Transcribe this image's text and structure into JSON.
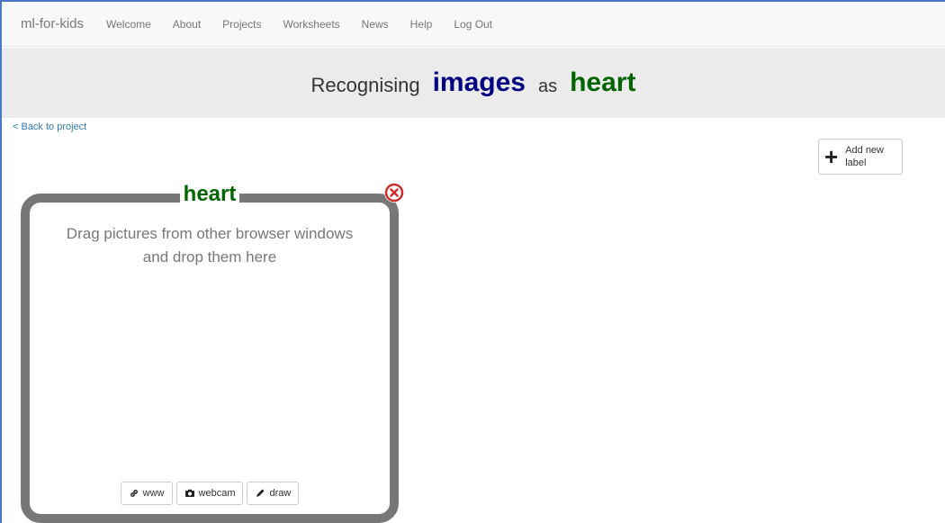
{
  "nav": {
    "brand": "ml-for-kids",
    "items": [
      "Welcome",
      "About",
      "Projects",
      "Worksheets",
      "News",
      "Help",
      "Log Out"
    ]
  },
  "banner": {
    "prefix": "Recognising",
    "type": "images",
    "joiner": "as",
    "label": "heart"
  },
  "back_link": "< Back to project",
  "add_label_button": {
    "line1": "Add new",
    "line2": "label"
  },
  "card": {
    "title": "heart",
    "hint_line1": "Drag pictures from other browser windows",
    "hint_line2": "and drop them here",
    "buttons": {
      "www": "www",
      "webcam": "webcam",
      "draw": "draw"
    }
  },
  "colors": {
    "type_color": "#000080",
    "label_color": "#006400",
    "link_color": "#337ab7",
    "card_border": "#777777",
    "delete_color": "#c9302c"
  }
}
